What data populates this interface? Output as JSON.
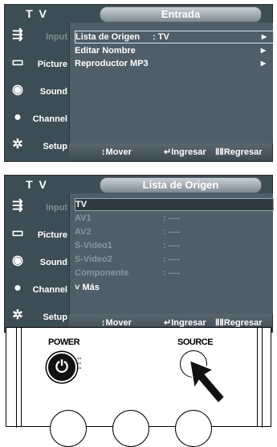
{
  "screen1": {
    "sidebar_title": "T V",
    "header": "Entrada",
    "sidebar": [
      {
        "label": "Input",
        "icon": "input-icon"
      },
      {
        "label": "Picture",
        "icon": "picture-icon"
      },
      {
        "label": "Sound",
        "icon": "sound-icon"
      },
      {
        "label": "Channel",
        "icon": "channel-icon"
      },
      {
        "label": "Setup",
        "icon": "setup-icon"
      }
    ],
    "items": [
      {
        "label": "Lista de Origen",
        "value": ": TV"
      },
      {
        "label": "Editar Nombre",
        "value": ""
      },
      {
        "label": "Reproductor MP3",
        "value": ""
      }
    ],
    "bottom": {
      "move": "↕Mover",
      "enter": "↵Ingresar",
      "back": "ⅡⅡRegresar"
    }
  },
  "screen2": {
    "sidebar_title": "T V",
    "header": "Lista de Origen",
    "items": [
      {
        "label": "TV",
        "value": ""
      },
      {
        "label": "AV1",
        "value": ": ----"
      },
      {
        "label": "AV2",
        "value": ": ----"
      },
      {
        "label": "S-Video1",
        "value": ": ----"
      },
      {
        "label": "S-Video2",
        "value": ": ----"
      },
      {
        "label": "Componente",
        "value": ": ----"
      }
    ],
    "more": "˅ Más",
    "bottom": {
      "move": "↕Mover",
      "enter": "↵Ingresar",
      "back": "ⅡⅡRegresar"
    }
  },
  "remote": {
    "power_label": "POWER",
    "source_label": "SOURCE"
  }
}
